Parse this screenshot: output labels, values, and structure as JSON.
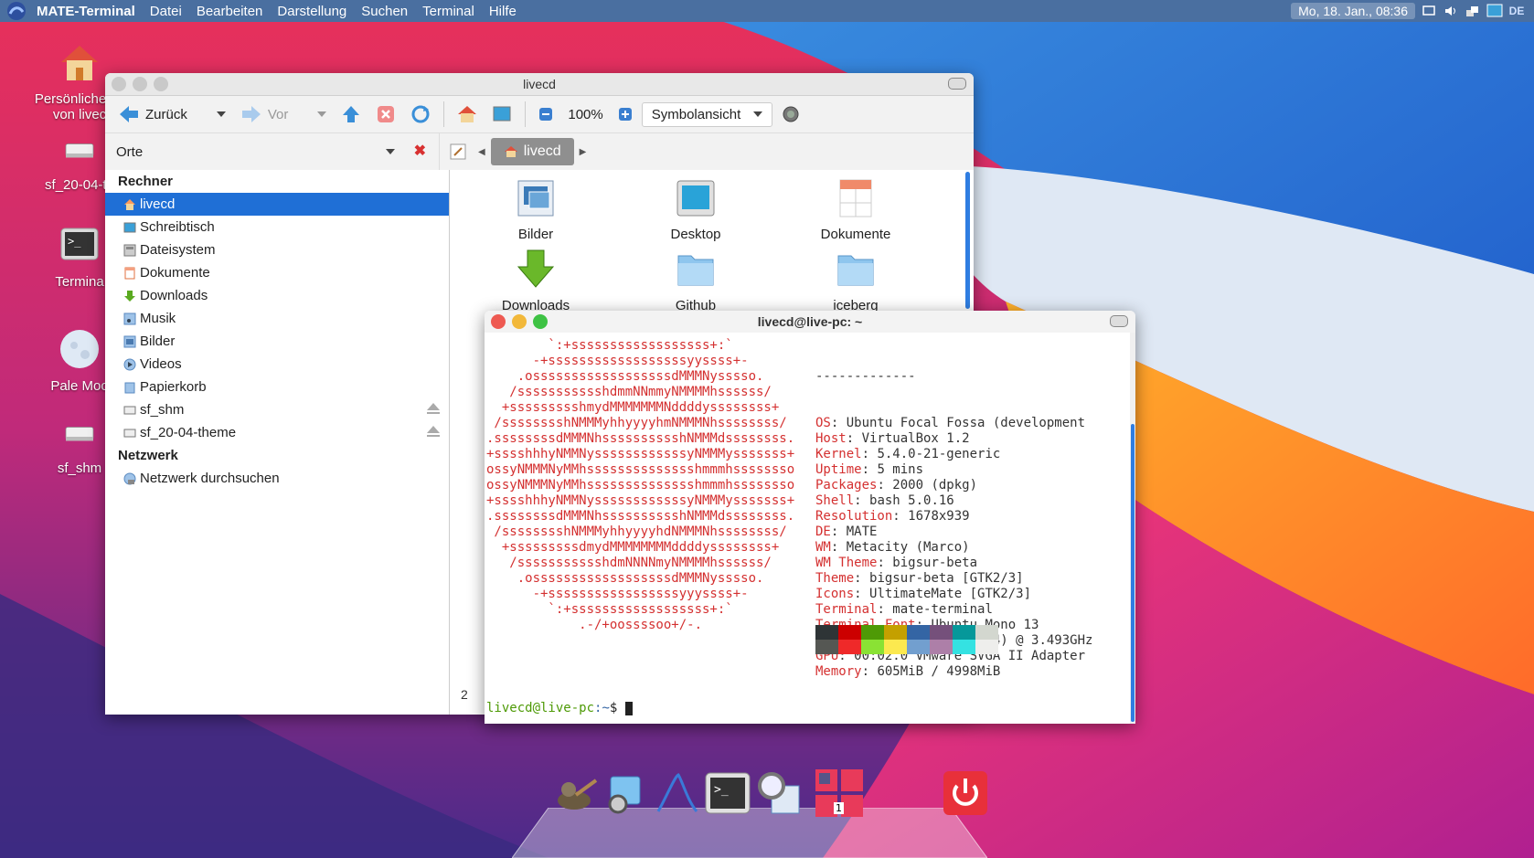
{
  "panel": {
    "app_name": "MATE-Terminal",
    "menus": [
      "Datei",
      "Bearbeiten",
      "Darstellung",
      "Suchen",
      "Terminal",
      "Hilfe"
    ],
    "clock": "Mo, 18. Jan., 08:36",
    "keyboard_layout": "DE"
  },
  "desktop_icons": [
    {
      "label": "Persönlicher Ordner von livecd",
      "line1": "Persönlicher C",
      "line2": "von livec",
      "icon": "home-icon"
    },
    {
      "label": "sf_20-04-theme",
      "line1": "sf_20-04-th",
      "icon": "drive-icon"
    },
    {
      "label": "Terminal",
      "line1": "Termina",
      "icon": "terminal-icon"
    },
    {
      "label": "Pale Moon",
      "line1": "Pale Moo",
      "icon": "pale-moon-icon"
    },
    {
      "label": "sf_shm",
      "line1": "sf_shm",
      "icon": "drive-icon"
    }
  ],
  "file_manager": {
    "title": "livecd",
    "back_label": "Zurück",
    "forward_label": "Vor",
    "zoom": "100%",
    "view_mode": "Symbolansicht",
    "places_label": "Orte",
    "path_button": "livecd",
    "sections": {
      "computer": "Rechner",
      "network": "Netzwerk"
    },
    "sidebar_items": [
      {
        "label": "livecd",
        "icon": "home-icon",
        "selected": true
      },
      {
        "label": "Schreibtisch",
        "icon": "desktop-icon"
      },
      {
        "label": "Dateisystem",
        "icon": "filesystem-icon"
      },
      {
        "label": "Dokumente",
        "icon": "documents-icon"
      },
      {
        "label": "Downloads",
        "icon": "downloads-icon"
      },
      {
        "label": "Musik",
        "icon": "music-icon"
      },
      {
        "label": "Bilder",
        "icon": "pictures-icon"
      },
      {
        "label": "Videos",
        "icon": "videos-icon"
      },
      {
        "label": "Papierkorb",
        "icon": "trash-icon"
      },
      {
        "label": "sf_shm",
        "icon": "drive-icon",
        "eject": true
      },
      {
        "label": "sf_20-04-theme",
        "icon": "drive-icon",
        "eject": true
      }
    ],
    "network_items": [
      {
        "label": "Netzwerk durchsuchen",
        "icon": "network-icon"
      }
    ],
    "files": [
      {
        "label": "Bilder",
        "icon": "pictures-folder-icon"
      },
      {
        "label": "Desktop",
        "icon": "desktop-folder-icon"
      },
      {
        "label": "Dokumente",
        "icon": "documents-folder-icon"
      },
      {
        "label": "Downloads",
        "icon": "downloads-folder-icon"
      },
      {
        "label": "Github",
        "icon": "folder-icon"
      },
      {
        "label": "iceberg",
        "icon": "folder-icon"
      }
    ],
    "status_fragment": "2"
  },
  "terminal": {
    "title": "livecd@live-pc: ~",
    "separator": "-------------",
    "ascii_art": [
      "        `:+ssssssssssssssssss+:`",
      "      -+ssssssssssssssssssyyssss+-",
      "    .ossssssssssssssssssdMMMNysssso.",
      "   /ssssssssssshdmmNNmmyNMMMMhssssss/",
      "  +ssssssssshmydMMMMMMMNddddyssssssss+",
      " /sssssssshNMMMyhhyyyyhmNMMMNhssssssss/",
      ".ssssssssdMMMNhsssssssssshNMMMdssssssss.",
      "+sssshhhyNMMNyssssssssssssyNMMMysssssss+",
      "ossyNMMMNyMMhsssssssssssssshmmmhssssssso",
      "ossyNMMMNyMMhsssssssssssssshmmmhssssssso",
      "+sssshhhyNMMNyssssssssssssyNMMMysssssss+",
      ".ssssssssdMMMNhsssssssssshNMMMdssssssss.",
      " /sssssssshNMMMyhhyyyyhdNMMMNhssssssss/",
      "  +sssssssssdmydMMMMMMMMddddyssssssss+",
      "   /ssssssssssshdmNNNNmyNMMMMhssssss/",
      "    .ossssssssssssssssssdMMMNysssso.",
      "      -+sssssssssssssssssyyyssss+-",
      "        `:+ssssssssssssssssss+:`",
      "            .-/+oossssoo+/-."
    ],
    "info": [
      {
        "key": "OS",
        "value": "Ubuntu Focal Fossa (development"
      },
      {
        "key": "Host",
        "value": "VirtualBox 1.2"
      },
      {
        "key": "Kernel",
        "value": "5.4.0-21-generic"
      },
      {
        "key": "Uptime",
        "value": "5 mins"
      },
      {
        "key": "Packages",
        "value": "2000 (dpkg)"
      },
      {
        "key": "Shell",
        "value": "bash 5.0.16"
      },
      {
        "key": "Resolution",
        "value": "1678x939"
      },
      {
        "key": "DE",
        "value": "MATE"
      },
      {
        "key": "WM",
        "value": "Metacity (Marco)"
      },
      {
        "key": "WM Theme",
        "value": "bigsur-beta"
      },
      {
        "key": "Theme",
        "value": "bigsur-beta [GTK2/3]"
      },
      {
        "key": "Icons",
        "value": "UltimateMate [GTK2/3]"
      },
      {
        "key": "Terminal",
        "value": "mate-terminal"
      },
      {
        "key": "Terminal Font",
        "value": "Ubuntu Mono 13"
      },
      {
        "key": "CPU",
        "value": "AMD Ryzen 3 1200 (4) @ 3.493GHz"
      },
      {
        "key": "GPU",
        "value": "00:02.0 VMware SVGA II Adapter"
      },
      {
        "key": "Memory",
        "value": "605MiB / 4998MiB"
      }
    ],
    "palette_colors": [
      "#2e3436",
      "#cc0000",
      "#4e9a06",
      "#c4a000",
      "#3465a4",
      "#75507b",
      "#06989a",
      "#d3d7cf",
      "#555753",
      "#ef2929",
      "#8ae234",
      "#fce94f",
      "#729fcf",
      "#ad7fa8",
      "#34e2e2",
      "#eeeeec"
    ],
    "prompt_user": "livecd@live-pc",
    "prompt_path": ":~",
    "prompt_symbol": "$ "
  },
  "dock": {
    "items": [
      {
        "name": "gimp",
        "icon": "gimp-icon"
      },
      {
        "name": "settings",
        "icon": "settings-gear-icon"
      },
      {
        "name": "arduino",
        "icon": "arc-icon"
      },
      {
        "name": "terminal",
        "icon": "terminal-icon"
      },
      {
        "name": "search",
        "icon": "search-icon"
      },
      {
        "name": "workspace",
        "icon": "workspace-icon",
        "badge": "1"
      },
      {
        "name": "shutdown",
        "icon": "power-icon"
      }
    ]
  },
  "colors": {
    "panel": "#4a6fa0",
    "selection": "#1f6fd6",
    "terminal_accent": "#d43030",
    "prompt_green": "#4e9a06",
    "prompt_blue": "#3465a4"
  }
}
